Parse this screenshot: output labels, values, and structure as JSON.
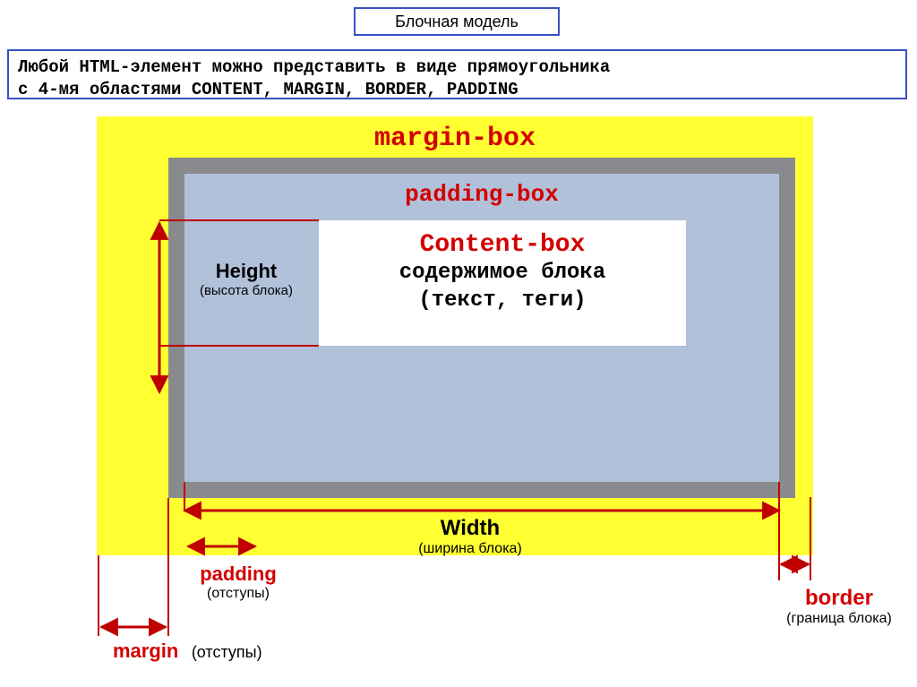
{
  "title": "Блочная модель",
  "description_line1": "Любой HTML-элемент можно представить в виде прямоугольника",
  "description_line2_prefix": "с 4-мя областями  ",
  "description_keywords": "CONTENT,  MARGIN, BORDER, PADDING",
  "boxes": {
    "margin": "margin-box",
    "padding": "padding-box",
    "content_title": "Content-box",
    "content_line1": "содержимое блока",
    "content_line2": "(текст, теги)"
  },
  "dims": {
    "height_label": "Height",
    "height_sub": "(высота блока)",
    "width_label": "Width",
    "width_sub": "(ширина блока)"
  },
  "callouts": {
    "padding_label": "padding",
    "padding_sub": "(отступы)",
    "margin_label": "margin",
    "margin_sub": "(отступы)",
    "border_label": "border",
    "border_sub": "(граница блока)"
  },
  "colors": {
    "margin_bg": "#ffff32",
    "border_bg": "#888a8d",
    "padding_bg": "#b1c1da",
    "content_bg": "#ffffff",
    "accent_red": "#d30000",
    "accent_blue": "#3a4fc4"
  }
}
